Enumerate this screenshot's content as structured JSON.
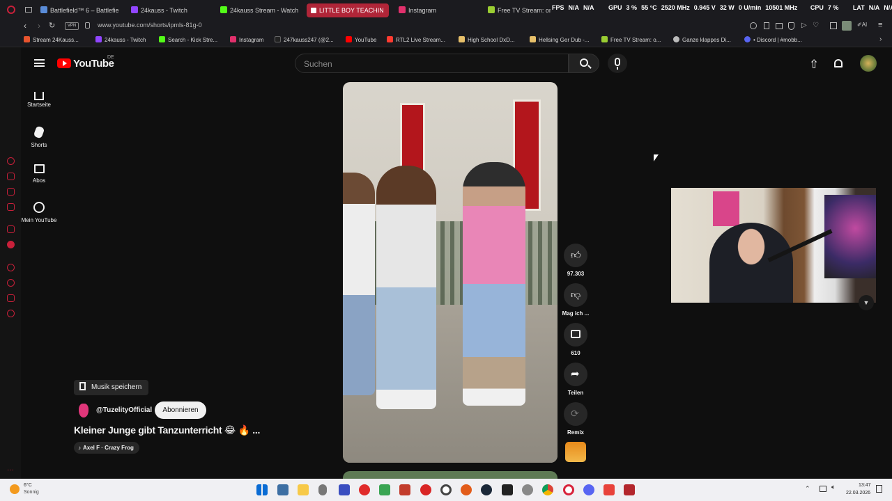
{
  "browser": {
    "tabs": [
      {
        "label": "Battlefield™ 6 – Battlefield",
        "color": "#5a8cd8"
      },
      {
        "label": "24kauss - Twitch",
        "color": "#9146ff"
      },
      {
        "label": "24kauss Stream - Watch l...",
        "color": "#53fc18"
      },
      {
        "label": "LITTLE BOY TEACHIN",
        "color": "#ff0000"
      },
      {
        "label": "Instagram",
        "color": "#e1306c"
      },
      {
        "label": "Free TV Stream: online s...",
        "color": "#9acd32"
      }
    ],
    "url_prefix": "www.youtube.com",
    "url_path": "/shorts/ipmls-81g-0",
    "bookmarks": [
      "Stream 24Kauss...",
      "24kauss - Twitch",
      "Search - Kick Stre...",
      "Instagram",
      "247kauss247 (@2...",
      "YouTube",
      "RTL2 Live Stream...",
      "High School DxD...",
      "Hellsing Ger Dub -...",
      "Free TV Stream: o...",
      "Ganze klappes Di...",
      "• Discord | #mobb..."
    ]
  },
  "hud": {
    "fps_label": "FPS",
    "fps": "N/A",
    "fps2": "N/A",
    "gpu_label": "GPU",
    "gpu_load": "3 %",
    "gpu_temp": "55 °C",
    "gpu_clock": "2520 MHz",
    "gpu_volt": "0.945 V",
    "gpu_power": "32 W",
    "gpu_fan": "0 U/min",
    "gpu_mem": "10501 MHz",
    "cpu_label": "CPU",
    "cpu_load": "7 %",
    "lat_label": "LAT",
    "lat": "N/A",
    "lat2": "N/A"
  },
  "youtube": {
    "logo": "YouTube",
    "region": "DE",
    "search_placeholder": "Suchen",
    "nav": [
      {
        "label": "Startseite",
        "icon": "home-icon"
      },
      {
        "label": "Shorts",
        "icon": "shorts-icon"
      },
      {
        "label": "Abos",
        "icon": "subscriptions-icon"
      },
      {
        "label": "Mein YouTube",
        "icon": "account-icon"
      }
    ],
    "short": {
      "music_label": "Musik speichern",
      "channel": "@TuzelityOfficial",
      "subscribe": "Abonnieren",
      "title": "Kleiner Junge gibt Tanzunterricht 😂 🔥 ...",
      "sound": "Axel F · Crazy Frog"
    },
    "actions": {
      "likes": "97.303",
      "dislike": "Mag ich ...",
      "comments": "610",
      "share": "Teilen",
      "remix": "Remix"
    }
  },
  "taskbar": {
    "weather_temp": "6°C",
    "weather_text": "Sonnig",
    "time": "13:47",
    "date": "22.03.2026"
  }
}
